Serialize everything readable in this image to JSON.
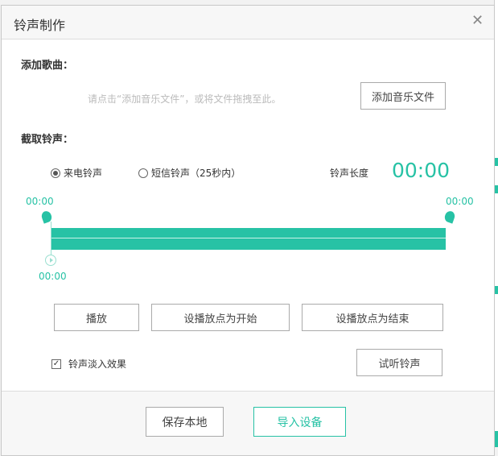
{
  "dialog": {
    "title": "铃声制作"
  },
  "add_song": {
    "heading": "添加歌曲：",
    "hint": "请点击“添加音乐文件”，或将文件拖拽至此。",
    "button": "添加音乐文件"
  },
  "trim": {
    "heading": "截取铃声：",
    "radios": [
      {
        "label": "来电铃声",
        "selected": true
      },
      {
        "label": "短信铃声（25秒内）",
        "selected": false
      }
    ],
    "length_label": "铃声长度",
    "length_value": "00:00",
    "start_time": "00:00",
    "end_time": "00:00",
    "play_position": "00:00"
  },
  "controls": {
    "play": "播放",
    "set_start": "设播放点为开始",
    "set_end": "设播放点为结束"
  },
  "fade": {
    "label": "铃声淡入效果",
    "checked": true
  },
  "preview_button": "试听铃声",
  "footer": {
    "save_local": "保存本地",
    "import_device": "导入设备"
  },
  "colors": {
    "accent": "#27c2a5"
  }
}
